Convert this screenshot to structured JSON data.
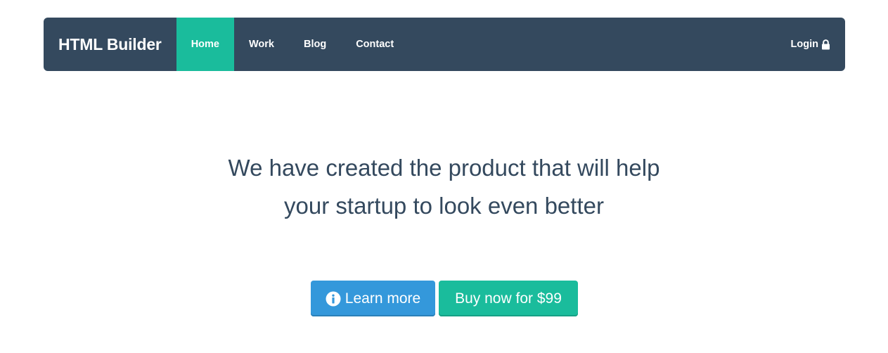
{
  "navbar": {
    "brand": "HTML Builder",
    "items": [
      {
        "label": "Home",
        "active": true
      },
      {
        "label": "Work",
        "active": false
      },
      {
        "label": "Blog",
        "active": false
      },
      {
        "label": "Contact",
        "active": false
      }
    ],
    "login_label": "Login",
    "login_icon": "lock-icon"
  },
  "hero": {
    "headline_line1": "We have created the product that will help",
    "headline_line2": "your startup to look even better"
  },
  "actions": {
    "learn_more_label": "Learn more",
    "learn_more_icon": "info-icon",
    "buy_label": "Buy now for $99"
  },
  "colors": {
    "navbar_bg": "#34495e",
    "active_bg": "#1abc9c",
    "info_button": "#3498db",
    "primary_button": "#1abc9c",
    "headline_text": "#34495e"
  }
}
